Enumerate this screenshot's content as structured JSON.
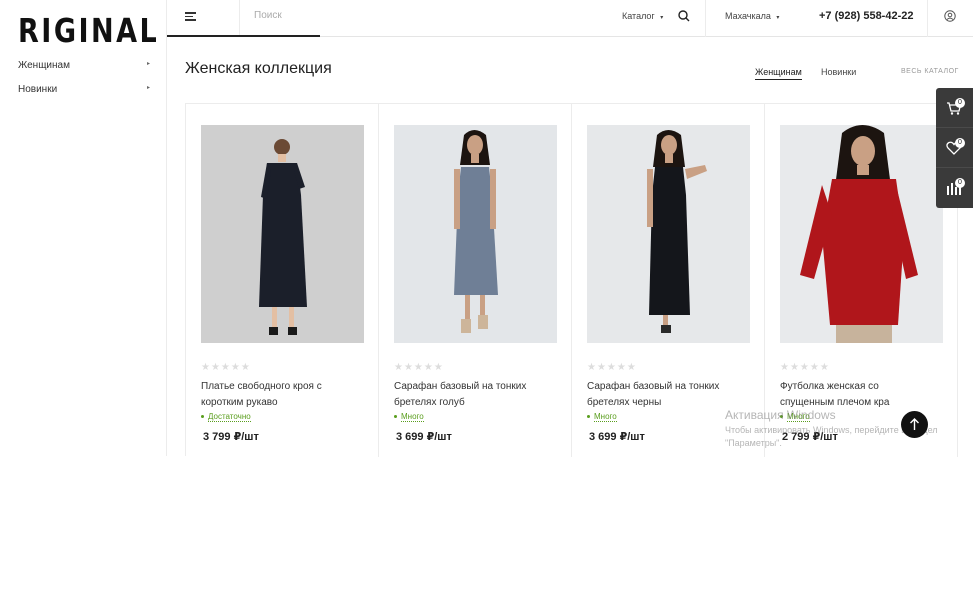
{
  "brand": {
    "logo_text": "RIGINAL"
  },
  "sidebar": {
    "items": [
      {
        "label": "Женщинам"
      },
      {
        "label": "Новинки"
      }
    ]
  },
  "header": {
    "search_placeholder": "Поиск",
    "catalog_label": "Каталог",
    "city_label": "Махачкала",
    "phone": "+7 (928) 558-42-22"
  },
  "section": {
    "title": "Женская коллекция",
    "tabs": [
      {
        "label": "Женщинам",
        "active": true
      },
      {
        "label": "Новинки",
        "active": false
      }
    ],
    "all_link": "ВЕСЬ КАТАЛОГ"
  },
  "products": [
    {
      "name": "Платье свободного кроя с коротким рукаво",
      "stock": "Достаточно",
      "price": "3 799 ₽/шт",
      "rating_stars": "★★★★★",
      "dress_color": "#1b1f2a",
      "bg": "#cfcfcf"
    },
    {
      "name": "Сарафан базовый на тонких бретелях голуб",
      "stock": "Много",
      "price": "3 699 ₽/шт",
      "rating_stars": "★★★★★",
      "dress_color": "#6f7f96",
      "bg": "#e3e6e9"
    },
    {
      "name": "Сарафан базовый на тонких бретелях черны",
      "stock": "Много",
      "price": "3 699 ₽/шт",
      "rating_stars": "★★★★★",
      "dress_color": "#14161b",
      "bg": "#e6e8ea"
    },
    {
      "name": "Футболка женская со спущенным плечом кра",
      "stock": "Много",
      "price": "2 799 ₽/шт",
      "rating_stars": "★★★★★",
      "dress_color": "#b0161b",
      "bg": "#e8eaec"
    }
  ],
  "float_panel": {
    "cart_count": "0",
    "favorites_count": "0",
    "compare_count": "0"
  },
  "watermark": {
    "title": "Активация Windows",
    "subtitle": "Чтобы активировать Windows, перейдите в раздел \"Параметры\"."
  },
  "colors": {
    "accent": "#5a9e1d",
    "panel": "#3a3a3a"
  }
}
